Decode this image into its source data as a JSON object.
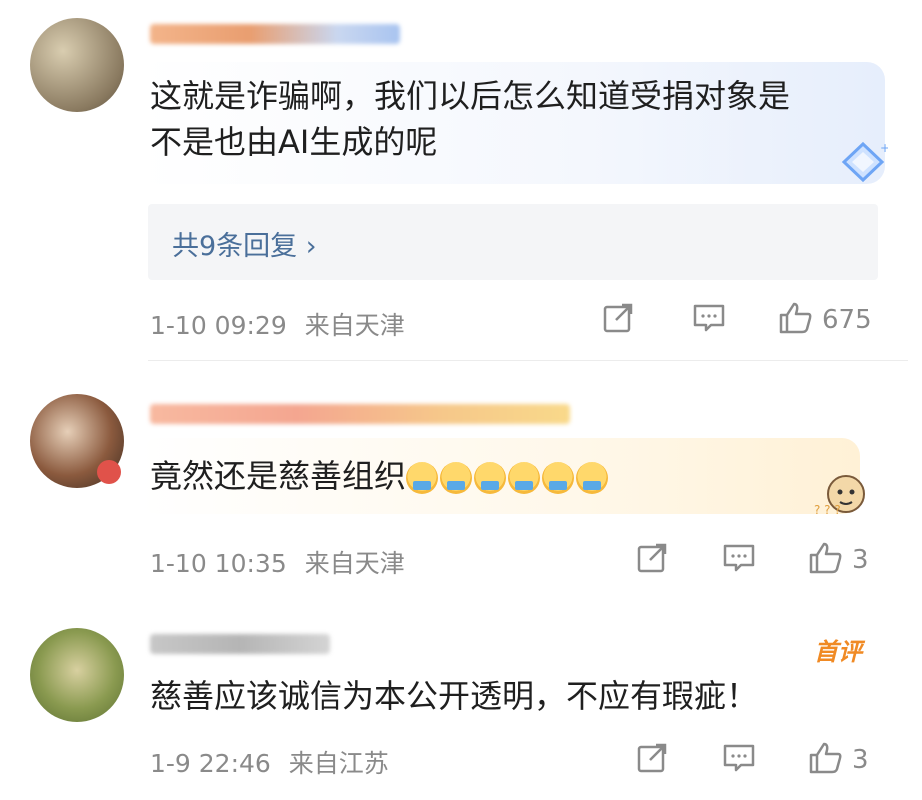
{
  "comments": [
    {
      "text_line1": "这就是诈骗啊，我们以后怎么知道受捐对象是",
      "text_line2": "不是也由AI生成的呢",
      "replies_label": "共9条回复 ›",
      "timestamp": "1-10 09:29",
      "location": "来自天津",
      "likes": "675"
    },
    {
      "text": "竟然还是慈善组织",
      "emoji": "crying-emoji",
      "emoji_count": 6,
      "timestamp": "1-10 10:35",
      "location": "来自天津",
      "likes": "3"
    },
    {
      "text": "慈善应该诚信为本公开透明，不应有瑕疵！",
      "badge": "首评",
      "timestamp": "1-9 22:46",
      "location": "来自江苏",
      "likes": "3"
    }
  ],
  "icons": {
    "share": "share-icon",
    "comment": "comment-icon",
    "like": "thumbs-up-icon"
  },
  "colors": {
    "link_blue": "#4a6f9a",
    "meta_gray": "#8a8a8a",
    "badge_orange": "#f08a24"
  }
}
